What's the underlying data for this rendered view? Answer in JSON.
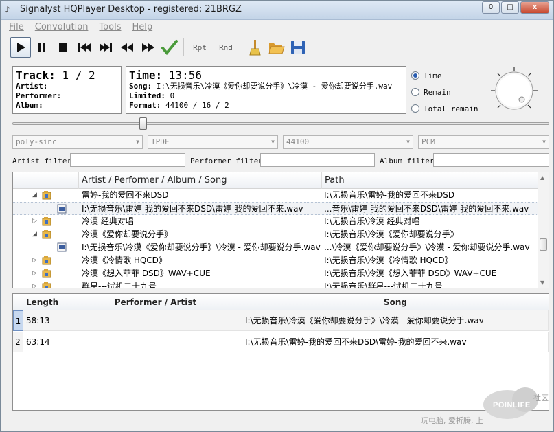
{
  "window": {
    "title": "Signalyst HQPlayer Desktop - registered: 21BRGZ",
    "minimize": "0",
    "maximize": "□",
    "close": "x"
  },
  "menu": [
    "File",
    "Convolution",
    "Tools",
    "Help"
  ],
  "toolbar": {
    "buttons": [
      "play-icon",
      "pause-icon",
      "stop-icon",
      "previous-icon",
      "next-icon",
      "rewind-icon",
      "fast-forward-icon",
      "apply-check-icon"
    ],
    "rpt": "Rpt",
    "rnd": "Rnd",
    "tools": [
      "clear-broom-icon",
      "open-folder-icon",
      "save-disk-icon"
    ]
  },
  "track_panel": {
    "track_label": "Track:",
    "track_value": "1 / 2",
    "artist_label": "Artist:",
    "performer_label": "Performer:",
    "album_label": "Album:"
  },
  "time_panel": {
    "time_label": "Time:",
    "time_value": "13:56",
    "song_label": "Song:",
    "song_value": "I:\\无损音乐\\冷漠《爱你却要说分手》\\冷漠 - 爱你却要说分手.wav",
    "limited_label": "Limited:",
    "limited_value": "0",
    "format_label": "Format:",
    "format_value": "44100 / 16 / 2"
  },
  "time_mode": {
    "options": [
      "Time",
      "Remain",
      "Total remain"
    ],
    "selected": "Time"
  },
  "position": 0.24,
  "combos": {
    "filter": "poly-sinc",
    "dither": "TPDF",
    "rate": "44100",
    "mode": "PCM"
  },
  "filters": {
    "artist_label": "Artist filter",
    "performer_label": "Performer filter",
    "album_label": "Album filter"
  },
  "library": {
    "headers": [
      "Artist / Performer / Album / Song",
      "Path"
    ],
    "rows": [
      {
        "kind": "folder",
        "expand": "◢",
        "name": "雷婷-我的爱回不来DSD",
        "path": "I:\\无损音乐\\雷婷-我的爱回不来DSD"
      },
      {
        "kind": "file",
        "expand": "",
        "name": "I:\\无损音乐\\雷婷-我的爱回不来DSD\\雷婷-我的爱回不来.wav",
        "path": "...音乐\\雷婷-我的爱回不来DSD\\雷婷-我的爱回不来.wav"
      },
      {
        "kind": "folder",
        "expand": "▷",
        "name": "冷漠 经典对唱",
        "path": "I:\\无损音乐\\冷漠 经典对唱"
      },
      {
        "kind": "folder",
        "expand": "◢",
        "name": "冷漠《爱你却要说分手》",
        "path": "I:\\无损音乐\\冷漠《爱你却要说分手》"
      },
      {
        "kind": "file",
        "expand": "",
        "name": "I:\\无损音乐\\冷漠《爱你却要说分手》\\冷漠 - 爱你却要说分手.wav",
        "path": "...\\冷漠《爱你却要说分手》\\冷漠 - 爱你却要说分手.wav"
      },
      {
        "kind": "folder",
        "expand": "▷",
        "name": "冷漠《冷情歌 HQCD》",
        "path": "I:\\无损音乐\\冷漠《冷情歌 HQCD》"
      },
      {
        "kind": "folder",
        "expand": "▷",
        "name": "冷漠《想入菲菲 DSD》WAV+CUE",
        "path": "I:\\无损音乐\\冷漠《想入菲菲 DSD》WAV+CUE"
      },
      {
        "kind": "folder",
        "expand": "▷",
        "name": "群星---试机二十九号",
        "path": "I:\\无损音乐\\群星---试机二十九号"
      }
    ]
  },
  "playlist": {
    "headers": [
      "Length",
      "Performer / Artist",
      "Song"
    ],
    "rows": [
      {
        "index": "1",
        "length": "58:13",
        "performer": "",
        "song": "I:\\无损音乐\\冷漠《爱你却要说分手》\\冷漠 - 爱你却要说分手.wav"
      },
      {
        "index": "2",
        "length": "63:14",
        "performer": "",
        "song": "I:\\无损音乐\\雷婷-我的爱回不来DSD\\雷婷-我的爱回不来.wav"
      }
    ]
  },
  "watermark": {
    "brand": "POINLIFE",
    "corner": "社区",
    "slogan": "玩电脑, 爱折腾, 上"
  }
}
